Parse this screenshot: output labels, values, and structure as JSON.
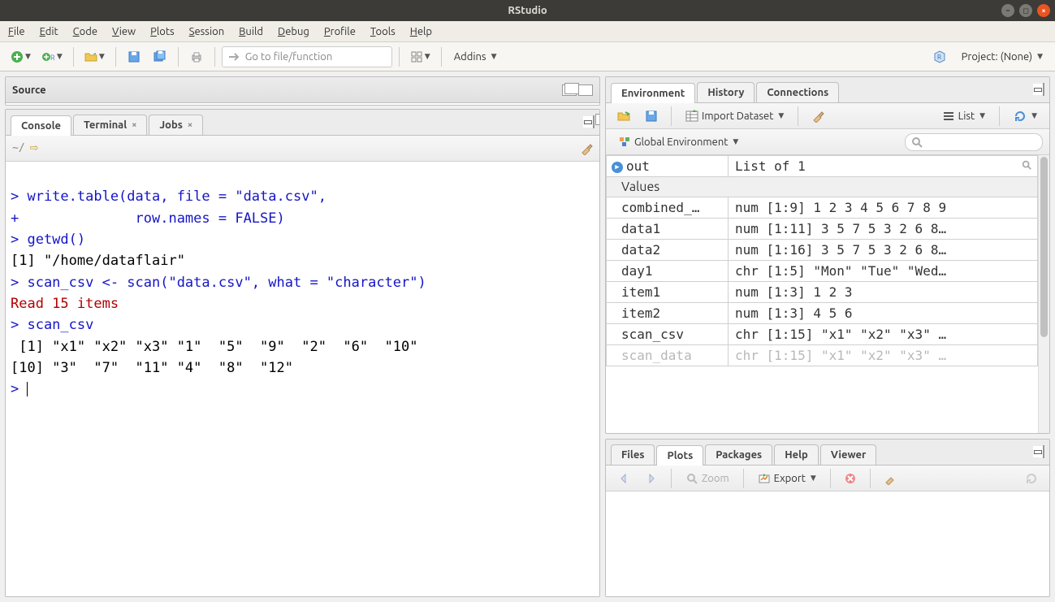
{
  "titlebar": {
    "title": "RStudio"
  },
  "menu": {
    "file": "File",
    "edit": "Edit",
    "code": "Code",
    "view": "View",
    "plots": "Plots",
    "session": "Session",
    "build": "Build",
    "debug": "Debug",
    "profile": "Profile",
    "tools": "Tools",
    "help": "Help"
  },
  "toolbar": {
    "goto_placeholder": "Go to file/function",
    "addins": "Addins",
    "project_label": "Project: (None)"
  },
  "source": {
    "title": "Source"
  },
  "leftTabs": {
    "console": "Console",
    "terminal": "Terminal",
    "jobs": "Jobs"
  },
  "consolePath": "~/",
  "console": {
    "l1": "> write.table(data, file = \"data.csv\",",
    "l2": "+              row.names = FALSE)",
    "l3": "> getwd()",
    "l4": "[1] \"/home/dataflair\"",
    "l5": "> scan_csv <- scan(\"data.csv\", what = \"character\")",
    "l6": "Read 15 items",
    "l7": "> scan_csv",
    "l8": " [1] \"x1\" \"x2\" \"x3\" \"1\"  \"5\"  \"9\"  \"2\"  \"6\"  \"10\"",
    "l9": "[10] \"3\"  \"7\"  \"11\" \"4\"  \"8\"  \"12\"",
    "l10": "> "
  },
  "envTabs": {
    "environment": "Environment",
    "history": "History",
    "connections": "Connections"
  },
  "envToolbar": {
    "import": "Import Dataset",
    "list": "List",
    "global": "Global Environment"
  },
  "envOut": {
    "name": "out",
    "value": "List of 1"
  },
  "envValuesHeader": "Values",
  "envRows": [
    {
      "name": "combined_…",
      "value": "num [1:9] 1 2 3 4 5 6 7 8 9"
    },
    {
      "name": "data1",
      "value": "num [1:11] 3 5 7 5 3 2 6 8…"
    },
    {
      "name": "data2",
      "value": "num [1:16] 3 5 7 5 3 2 6 8…"
    },
    {
      "name": "day1",
      "value": "chr [1:5] \"Mon\" \"Tue\" \"Wed…"
    },
    {
      "name": "item1",
      "value": "num [1:3] 1 2 3"
    },
    {
      "name": "item2",
      "value": "num [1:3] 4 5 6"
    },
    {
      "name": "scan_csv",
      "value": "chr [1:15] \"x1\" \"x2\" \"x3\" …"
    },
    {
      "name": "scan_data",
      "value": "chr [1:15] \"x1\" \"x2\" \"x3\" …"
    }
  ],
  "bottomTabs": {
    "files": "Files",
    "plots": "Plots",
    "packages": "Packages",
    "help": "Help",
    "viewer": "Viewer"
  },
  "plotsToolbar": {
    "zoom": "Zoom",
    "export": "Export"
  }
}
